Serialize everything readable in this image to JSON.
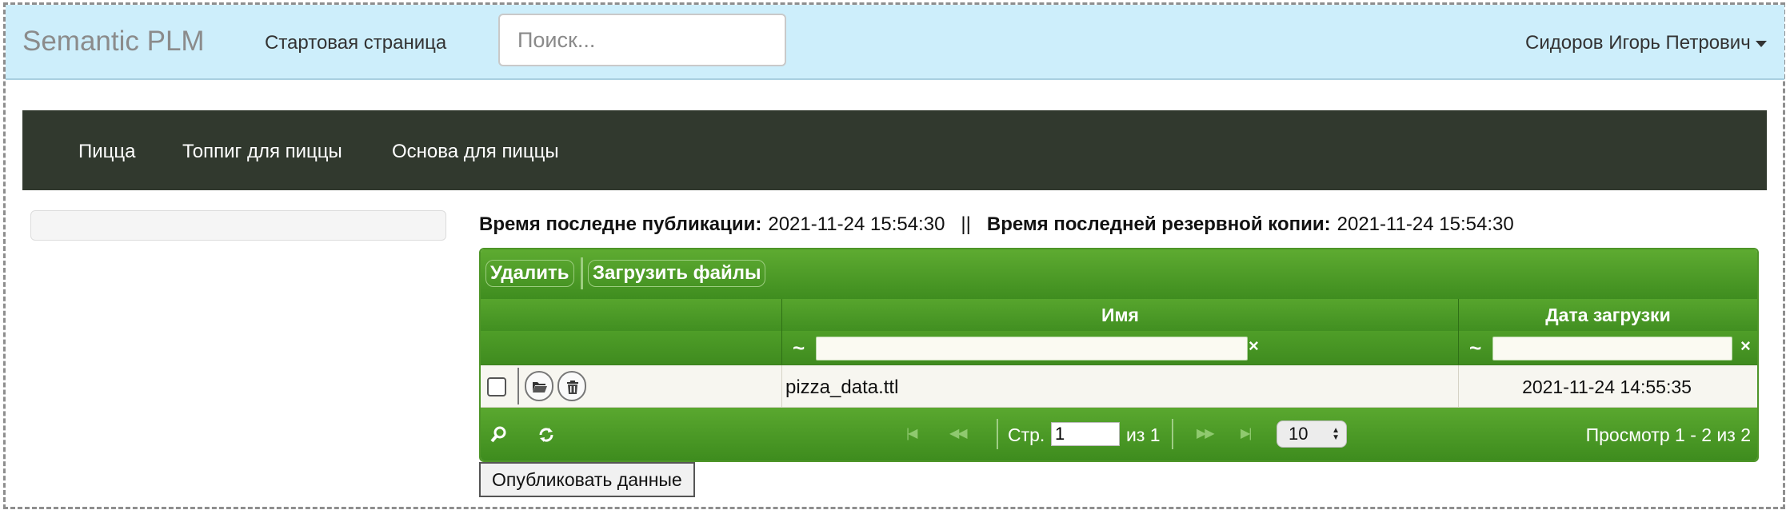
{
  "navbar": {
    "brand": "Semantic PLM",
    "start_link": "Стартовая страница",
    "search_placeholder": "Поиск...",
    "user_name": "Сидоров Игорь Петрович"
  },
  "menu": {
    "items": [
      {
        "label": "Пицца"
      },
      {
        "label": "Топпиг для пиццы"
      },
      {
        "label": "Основа для пиццы"
      }
    ]
  },
  "info": {
    "publish_label": "Время последне публикации:",
    "publish_time": "2021-11-24 15:54:30",
    "separator": "||",
    "backup_label": "Время последней резервной копии:",
    "backup_time": "2021-11-24 15:54:30"
  },
  "grid": {
    "toolbar": {
      "delete_label": "Удалить",
      "upload_label": "Загрузить файлы"
    },
    "columns": [
      {
        "label": ""
      },
      {
        "label": "Имя"
      },
      {
        "label": "Дата загрузки"
      }
    ],
    "filter_symbol": "~",
    "clear_symbol": "×",
    "rows": [
      {
        "name": "pizza_data.ttl",
        "date": "2021-11-24 14:55:35",
        "checked": false
      }
    ],
    "pager": {
      "page_label": "Стр.",
      "page_value": "1",
      "of_label": "из 1",
      "page_size": "10",
      "view_text": "Просмотр 1 - 2 из 2"
    }
  },
  "publish_button": "Опубликовать данные",
  "colors": {
    "navbar_bg": "#cdeefb",
    "menu_bg": "#31392e",
    "grid_green": "#4e9528"
  },
  "icons": [
    "caret-down-icon",
    "folder-open-icon",
    "trash-icon",
    "search-icon",
    "refresh-icon",
    "first-page-icon",
    "prev-page-icon",
    "next-page-icon",
    "last-page-icon",
    "spinner-arrows-icon"
  ]
}
